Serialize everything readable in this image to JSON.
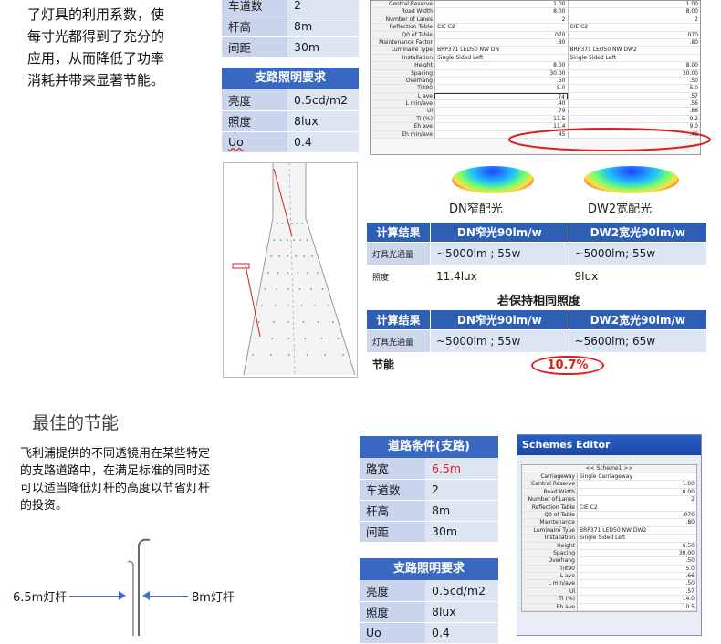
{
  "intro": {
    "lines": [
      "了灯具的利用系数，使",
      "每寸光都得到了充分的",
      "应用，从而降低了功率",
      "消耗并带来显著节能。"
    ]
  },
  "top_table": {
    "rows": [
      {
        "label": "车道数",
        "value": "2"
      },
      {
        "label": "杆高",
        "value": "8m"
      },
      {
        "label": "间距",
        "value": "30m"
      }
    ]
  },
  "top_lighting": {
    "title": "支路照明要求",
    "rows": [
      {
        "label": "亮度",
        "value": "0.5cd/m2"
      },
      {
        "label": "照度",
        "value": "8lux"
      },
      {
        "label": "Uo",
        "value": "0.4"
      }
    ]
  },
  "schemes_top": {
    "rows": [
      {
        "label": "Central Reserve",
        "c1": "1.00",
        "c2": "1.00"
      },
      {
        "label": "Road Width",
        "c1": "8.00",
        "c2": "8.00"
      },
      {
        "label": "Number of Lanes",
        "c1": "2",
        "c2": "2"
      },
      {
        "label": "Reflection Table",
        "c1": "CIE C2",
        "c2": "CIE C2"
      },
      {
        "label": "Q0 of Table",
        "c1": ".070",
        ".c2": "",
        "c2": ".070"
      },
      {
        "label": "Maintenance Factor",
        "c1": ".80",
        "c2": ".80"
      },
      {
        "label": "Luminaire Type",
        "c1": "BRP371 LED50 NW DN",
        "c2": "BRP371 LED50 NW DW2"
      },
      {
        "label": "Installation",
        "c1": "Single Sided Left",
        "c2": "Single Sided Left"
      },
      {
        "label": "Height",
        "c1": "8.00",
        "c2": "8.00"
      },
      {
        "label": "Spacing",
        "c1": "30.00",
        "c2": "30.00"
      },
      {
        "label": "Overhang",
        "c1": ".50",
        "c2": ".50"
      },
      {
        "label": "Tilt90",
        "c1": "5.0",
        "c2": "5.0"
      },
      {
        "label": "L ave",
        "c1": ".74",
        "c2": ".57"
      },
      {
        "label": "L min/ave",
        "c1": ".40",
        "c2": ".56"
      },
      {
        "label": "Ul",
        "c1": ".79",
        "c2": ".86"
      },
      {
        "label": "TI (%)",
        "c1": "11.5",
        "c2": "9.2"
      },
      {
        "label": "Eh ave",
        "c1": "11.4",
        "c2": "9.0"
      },
      {
        "label": "Eh min/ave",
        "c1": ".45",
        "c2": ".48"
      }
    ]
  },
  "beam_labels": {
    "dn": "DN窄配光",
    "dw2": "DW2宽配光"
  },
  "calc1": {
    "headers": [
      "计算结果",
      "DN窄光90lm/w",
      "DW2宽光90lm/w"
    ],
    "rows": [
      {
        "label": "灯具光通量",
        "a": "~5000lm ; 55w",
        "b": "~5000lm; 55w"
      },
      {
        "label": "照度",
        "a": "11.4lux",
        "b": "9lux"
      }
    ]
  },
  "same_illum_title": "若保持相同照度",
  "calc2": {
    "headers": [
      "计算结果",
      "DN窄光90lm/w",
      "DW2宽光90lm/w"
    ],
    "rows": [
      {
        "label": "灯具光通量",
        "a": "~5000lm ; 55w",
        "b": "~5600lm; 65w"
      }
    ],
    "saving_label": "节能",
    "saving_value": "10.7%"
  },
  "section2": {
    "title": "最佳的节能",
    "lines": [
      "飞利浦提供的不同透镜用在某些特定",
      "的支路道路中，在满足标准的同时还",
      "可以适当降低灯杆的高度以节省灯杆",
      "的投资。"
    ],
    "pole_left": "6.5m灯杆",
    "pole_right": "8m灯杆"
  },
  "road_conditions": {
    "title": "道路条件(支路)",
    "rows": [
      {
        "label": "路宽",
        "value": "6.5m"
      },
      {
        "label": "车道数",
        "value": "2"
      },
      {
        "label": "杆高",
        "value": "8m"
      },
      {
        "label": "间距",
        "value": "30m"
      }
    ]
  },
  "bottom_lighting": {
    "title": "支路照明要求",
    "rows": [
      {
        "label": "亮度",
        "value": "0.5cd/m2"
      },
      {
        "label": "照度",
        "value": "8lux"
      },
      {
        "label": "Uo",
        "value": "0.4"
      }
    ]
  },
  "schemes_editor": {
    "title": "Schemes Editor",
    "tab": "<< Scheme1 >>",
    "rows": [
      {
        "label": "Carriageway",
        "value": "Single Carriageway"
      },
      {
        "label": "Central Reserve",
        "value": "1.00"
      },
      {
        "label": "Road Width",
        "value": "8.00"
      },
      {
        "label": "Number of Lanes",
        "value": "2"
      },
      {
        "label": "Reflection Table",
        "value": "CIE C2"
      },
      {
        "label": "Q0 of Table",
        "value": ".070"
      },
      {
        "label": "Maintenance Factor",
        "value": ".80"
      },
      {
        "label": "Luminaire Type",
        "value": "BRP371 LED50 NW DW2"
      },
      {
        "label": "Installation",
        "value": "Single Sided Left"
      },
      {
        "label": "Height",
        "value": "6.50"
      },
      {
        "label": "Spacing",
        "value": "30.00"
      },
      {
        "label": "Overhang",
        "value": ".50"
      },
      {
        "label": "Tilt90",
        "value": "5.0"
      },
      {
        "label": "L ave",
        "value": ".66"
      },
      {
        "label": "L min/ave",
        "value": ".50"
      },
      {
        "label": "Ul",
        "value": ".57"
      },
      {
        "label": "TI (%)",
        "value": "14.0"
      },
      {
        "label": "Eh ave",
        "value": "10.5"
      }
    ]
  },
  "colors": {
    "accent": "#2f5fb5",
    "highlight": "#d8201c"
  }
}
